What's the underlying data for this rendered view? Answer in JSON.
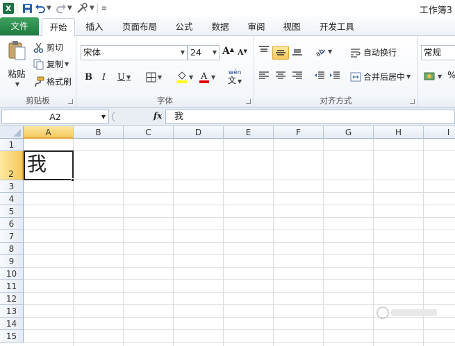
{
  "window": {
    "title": "工作簿3"
  },
  "quick_access": {
    "logo": "X"
  },
  "tabs": [
    "文件",
    "开始",
    "插入",
    "页面布局",
    "公式",
    "数据",
    "审阅",
    "视图",
    "开发工具"
  ],
  "ribbon": {
    "clipboard": {
      "label": "剪贴板",
      "paste": "粘贴",
      "cut": "剪切",
      "copy": "复制",
      "format_painter": "格式刷"
    },
    "font": {
      "label": "字体",
      "font_name": "宋体",
      "font_size": "24",
      "bold": "B",
      "italic": "I",
      "underline": "U",
      "grow": "A",
      "shrink": "A",
      "phonetic": "wén"
    },
    "alignment": {
      "label": "对齐方式",
      "wrap_text": "自动换行",
      "merge_center": "合并后居中"
    },
    "number": {
      "format": "常规",
      "percent": "%"
    }
  },
  "formula_bar": {
    "name_box": "A2",
    "fx": "fx",
    "value": "我"
  },
  "sheet": {
    "columns": [
      "A",
      "B",
      "C",
      "D",
      "E",
      "F",
      "G",
      "H",
      "I"
    ],
    "rows": [
      "1",
      "2",
      "3",
      "4",
      "5",
      "6",
      "7",
      "8",
      "9",
      "10",
      "11",
      "12",
      "13",
      "14",
      "15"
    ],
    "active_cell": "A2",
    "cell_a2": "我"
  },
  "colors": {
    "file_tab": "#1f7a3f",
    "selection": "#f5c85c",
    "header": "#e4ebf4"
  }
}
